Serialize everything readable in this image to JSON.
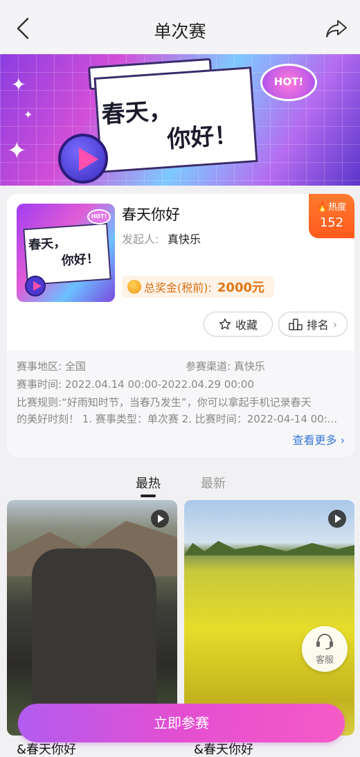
{
  "nav": {
    "title": "单次赛"
  },
  "banner": {
    "headline_line1": "春天，",
    "headline_line2": "你好！",
    "hot_badge": "HOT!"
  },
  "event": {
    "title": "春天你好",
    "organizer_label": "发起人:",
    "organizer": "真快乐",
    "heat_label": "热度",
    "heat_value": "152",
    "prize_label": "总奖金(税前):",
    "prize_value": "2000元",
    "thumb_line1": "春天，",
    "thumb_line2": "你好！",
    "thumb_hot": "HOT!",
    "favorite_label": "收藏",
    "rank_label": "排名"
  },
  "details": {
    "region_label": "赛事地区:",
    "region": "全国",
    "channel_label": "参赛渠道:",
    "channel": "真快乐",
    "time_label": "赛事时间:",
    "time": "2022.04.14 00:00-2022.04.29 00:00",
    "rules_line1": "比赛规则:“好雨知时节，当春乃发生”，你可以拿起手机记录春天",
    "rules_line2": "的美好时刻！ 1. 赛事类型：单次赛 2. 比赛时间：2022-04-14 00:...",
    "more_label": "查看更多"
  },
  "tabs": [
    {
      "label": "最热"
    },
    {
      "label": "最新"
    }
  ],
  "feed": [
    {
      "caption": "&春天你好"
    },
    {
      "caption": "&春天你好"
    }
  ],
  "customer_service": "客服",
  "cta": "立即参赛"
}
